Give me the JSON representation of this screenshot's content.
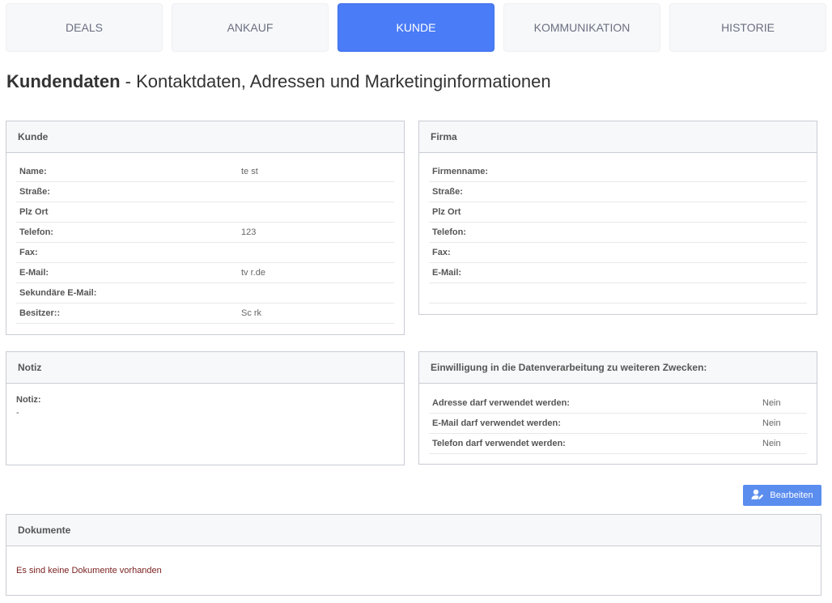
{
  "tabs": [
    {
      "label": "DEALS",
      "active": false
    },
    {
      "label": "ANKAUF",
      "active": false
    },
    {
      "label": "KUNDE",
      "active": true
    },
    {
      "label": "KOMMUNIKATION",
      "active": false
    },
    {
      "label": "HISTORIE",
      "active": false
    }
  ],
  "page": {
    "title_bold": "Kundendaten",
    "title_rest": " - Kontaktdaten, Adressen und Marketinginformationen"
  },
  "kunde": {
    "title": "Kunde",
    "rows": [
      {
        "label": "Name:",
        "value": "te     st"
      },
      {
        "label": "Straße:",
        "value": ""
      },
      {
        "label": "Plz Ort",
        "value": ""
      },
      {
        "label": "Telefon:",
        "value": "123"
      },
      {
        "label": "Fax:",
        "value": ""
      },
      {
        "label": "E-Mail:",
        "value": "tv          r.de"
      },
      {
        "label": "Sekundäre E-Mail:",
        "value": ""
      },
      {
        "label": "Besitzer::",
        "value": "Sc           rk"
      }
    ]
  },
  "firma": {
    "title": "Firma",
    "rows": [
      {
        "label": "Firmenname:",
        "value": ""
      },
      {
        "label": "Straße:",
        "value": ""
      },
      {
        "label": "Plz Ort",
        "value": ""
      },
      {
        "label": "Telefon:",
        "value": ""
      },
      {
        "label": "Fax:",
        "value": ""
      },
      {
        "label": "E-Mail:",
        "value": ""
      },
      {
        "label": "",
        "value": ""
      }
    ]
  },
  "notiz": {
    "title": "Notiz",
    "label": "Notiz:",
    "value": "-"
  },
  "einwilligung": {
    "title": "Einwilligung in die Datenverarbeitung zu weiteren Zwecken:",
    "rows": [
      {
        "label": "Adresse darf verwendet werden:",
        "value": "Nein"
      },
      {
        "label": "E-Mail darf verwendet werden:",
        "value": "Nein"
      },
      {
        "label": "Telefon darf verwendet werden:",
        "value": "Nein"
      }
    ]
  },
  "actions": {
    "edit_label": "Bearbeiten",
    "edit_icon": "user-edit-icon"
  },
  "dokumente": {
    "title": "Dokumente",
    "empty_message": "Es sind keine Dokumente vorhanden"
  },
  "colors": {
    "accent": "#4a7cf7",
    "button": "#5b8def",
    "empty_text": "#7a1f1f"
  }
}
